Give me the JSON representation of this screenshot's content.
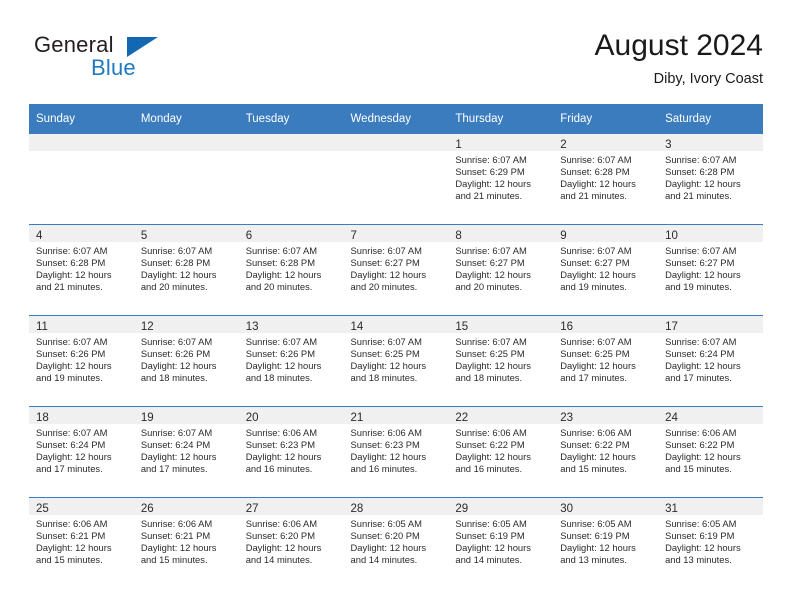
{
  "brand": {
    "word_general": "General",
    "word_blue": "Blue",
    "triangle_color": "#1268b3",
    "blue_color": "#1f7ac0"
  },
  "header": {
    "title": "August 2024",
    "subtitle": "Diby, Ivory Coast"
  },
  "theme": {
    "header_row_bg": "#3b7cbf",
    "daynum_band_bg": "#f0f0f0",
    "grid_line": "#3b7cbf",
    "text": "#2b2b2b"
  },
  "weekday_headers": [
    "Sunday",
    "Monday",
    "Tuesday",
    "Wednesday",
    "Thursday",
    "Friday",
    "Saturday"
  ],
  "labels": {
    "sunrise_prefix": "Sunrise:",
    "sunset_prefix": "Sunset:",
    "daylight_prefix": "Daylight:"
  },
  "weeks": [
    [
      {
        "day": "",
        "empty": true
      },
      {
        "day": "",
        "empty": true
      },
      {
        "day": "",
        "empty": true
      },
      {
        "day": "",
        "empty": true
      },
      {
        "day": "1",
        "sunrise": "Sunrise: 6:07 AM",
        "sunset": "Sunset: 6:29 PM",
        "daylight_1": "Daylight: 12 hours",
        "daylight_2": "and 21 minutes."
      },
      {
        "day": "2",
        "sunrise": "Sunrise: 6:07 AM",
        "sunset": "Sunset: 6:28 PM",
        "daylight_1": "Daylight: 12 hours",
        "daylight_2": "and 21 minutes."
      },
      {
        "day": "3",
        "sunrise": "Sunrise: 6:07 AM",
        "sunset": "Sunset: 6:28 PM",
        "daylight_1": "Daylight: 12 hours",
        "daylight_2": "and 21 minutes."
      }
    ],
    [
      {
        "day": "4",
        "sunrise": "Sunrise: 6:07 AM",
        "sunset": "Sunset: 6:28 PM",
        "daylight_1": "Daylight: 12 hours",
        "daylight_2": "and 21 minutes."
      },
      {
        "day": "5",
        "sunrise": "Sunrise: 6:07 AM",
        "sunset": "Sunset: 6:28 PM",
        "daylight_1": "Daylight: 12 hours",
        "daylight_2": "and 20 minutes."
      },
      {
        "day": "6",
        "sunrise": "Sunrise: 6:07 AM",
        "sunset": "Sunset: 6:28 PM",
        "daylight_1": "Daylight: 12 hours",
        "daylight_2": "and 20 minutes."
      },
      {
        "day": "7",
        "sunrise": "Sunrise: 6:07 AM",
        "sunset": "Sunset: 6:27 PM",
        "daylight_1": "Daylight: 12 hours",
        "daylight_2": "and 20 minutes."
      },
      {
        "day": "8",
        "sunrise": "Sunrise: 6:07 AM",
        "sunset": "Sunset: 6:27 PM",
        "daylight_1": "Daylight: 12 hours",
        "daylight_2": "and 20 minutes."
      },
      {
        "day": "9",
        "sunrise": "Sunrise: 6:07 AM",
        "sunset": "Sunset: 6:27 PM",
        "daylight_1": "Daylight: 12 hours",
        "daylight_2": "and 19 minutes."
      },
      {
        "day": "10",
        "sunrise": "Sunrise: 6:07 AM",
        "sunset": "Sunset: 6:27 PM",
        "daylight_1": "Daylight: 12 hours",
        "daylight_2": "and 19 minutes."
      }
    ],
    [
      {
        "day": "11",
        "sunrise": "Sunrise: 6:07 AM",
        "sunset": "Sunset: 6:26 PM",
        "daylight_1": "Daylight: 12 hours",
        "daylight_2": "and 19 minutes."
      },
      {
        "day": "12",
        "sunrise": "Sunrise: 6:07 AM",
        "sunset": "Sunset: 6:26 PM",
        "daylight_1": "Daylight: 12 hours",
        "daylight_2": "and 18 minutes."
      },
      {
        "day": "13",
        "sunrise": "Sunrise: 6:07 AM",
        "sunset": "Sunset: 6:26 PM",
        "daylight_1": "Daylight: 12 hours",
        "daylight_2": "and 18 minutes."
      },
      {
        "day": "14",
        "sunrise": "Sunrise: 6:07 AM",
        "sunset": "Sunset: 6:25 PM",
        "daylight_1": "Daylight: 12 hours",
        "daylight_2": "and 18 minutes."
      },
      {
        "day": "15",
        "sunrise": "Sunrise: 6:07 AM",
        "sunset": "Sunset: 6:25 PM",
        "daylight_1": "Daylight: 12 hours",
        "daylight_2": "and 18 minutes."
      },
      {
        "day": "16",
        "sunrise": "Sunrise: 6:07 AM",
        "sunset": "Sunset: 6:25 PM",
        "daylight_1": "Daylight: 12 hours",
        "daylight_2": "and 17 minutes."
      },
      {
        "day": "17",
        "sunrise": "Sunrise: 6:07 AM",
        "sunset": "Sunset: 6:24 PM",
        "daylight_1": "Daylight: 12 hours",
        "daylight_2": "and 17 minutes."
      }
    ],
    [
      {
        "day": "18",
        "sunrise": "Sunrise: 6:07 AM",
        "sunset": "Sunset: 6:24 PM",
        "daylight_1": "Daylight: 12 hours",
        "daylight_2": "and 17 minutes."
      },
      {
        "day": "19",
        "sunrise": "Sunrise: 6:07 AM",
        "sunset": "Sunset: 6:24 PM",
        "daylight_1": "Daylight: 12 hours",
        "daylight_2": "and 17 minutes."
      },
      {
        "day": "20",
        "sunrise": "Sunrise: 6:06 AM",
        "sunset": "Sunset: 6:23 PM",
        "daylight_1": "Daylight: 12 hours",
        "daylight_2": "and 16 minutes."
      },
      {
        "day": "21",
        "sunrise": "Sunrise: 6:06 AM",
        "sunset": "Sunset: 6:23 PM",
        "daylight_1": "Daylight: 12 hours",
        "daylight_2": "and 16 minutes."
      },
      {
        "day": "22",
        "sunrise": "Sunrise: 6:06 AM",
        "sunset": "Sunset: 6:22 PM",
        "daylight_1": "Daylight: 12 hours",
        "daylight_2": "and 16 minutes."
      },
      {
        "day": "23",
        "sunrise": "Sunrise: 6:06 AM",
        "sunset": "Sunset: 6:22 PM",
        "daylight_1": "Daylight: 12 hours",
        "daylight_2": "and 15 minutes."
      },
      {
        "day": "24",
        "sunrise": "Sunrise: 6:06 AM",
        "sunset": "Sunset: 6:22 PM",
        "daylight_1": "Daylight: 12 hours",
        "daylight_2": "and 15 minutes."
      }
    ],
    [
      {
        "day": "25",
        "sunrise": "Sunrise: 6:06 AM",
        "sunset": "Sunset: 6:21 PM",
        "daylight_1": "Daylight: 12 hours",
        "daylight_2": "and 15 minutes."
      },
      {
        "day": "26",
        "sunrise": "Sunrise: 6:06 AM",
        "sunset": "Sunset: 6:21 PM",
        "daylight_1": "Daylight: 12 hours",
        "daylight_2": "and 15 minutes."
      },
      {
        "day": "27",
        "sunrise": "Sunrise: 6:06 AM",
        "sunset": "Sunset: 6:20 PM",
        "daylight_1": "Daylight: 12 hours",
        "daylight_2": "and 14 minutes."
      },
      {
        "day": "28",
        "sunrise": "Sunrise: 6:05 AM",
        "sunset": "Sunset: 6:20 PM",
        "daylight_1": "Daylight: 12 hours",
        "daylight_2": "and 14 minutes."
      },
      {
        "day": "29",
        "sunrise": "Sunrise: 6:05 AM",
        "sunset": "Sunset: 6:19 PM",
        "daylight_1": "Daylight: 12 hours",
        "daylight_2": "and 14 minutes."
      },
      {
        "day": "30",
        "sunrise": "Sunrise: 6:05 AM",
        "sunset": "Sunset: 6:19 PM",
        "daylight_1": "Daylight: 12 hours",
        "daylight_2": "and 13 minutes."
      },
      {
        "day": "31",
        "sunrise": "Sunrise: 6:05 AM",
        "sunset": "Sunset: 6:19 PM",
        "daylight_1": "Daylight: 12 hours",
        "daylight_2": "and 13 minutes."
      }
    ]
  ]
}
